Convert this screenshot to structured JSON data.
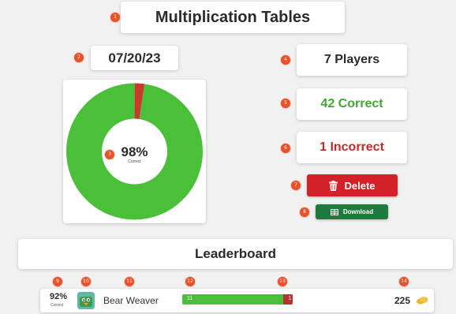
{
  "title": "Multiplication Tables",
  "date": "07/20/23",
  "stats": {
    "players": "7 Players",
    "correct": "42 Correct",
    "incorrect": "1 Incorrect"
  },
  "donut": {
    "percent_label": "98%",
    "caption": "Correct",
    "correct_fraction": 0.977
  },
  "buttons": {
    "delete_label": "Delete",
    "download_label": "Download"
  },
  "leaderboard": {
    "heading": "Leaderboard",
    "rows": [
      {
        "percent": "92%",
        "percent_caption": "Correct",
        "name": "Bear Weaver",
        "correct_count": "11",
        "incorrect_count": "1",
        "correct_fraction": 0.917,
        "score": "225",
        "avatar_icon": "duck-avatar-icon",
        "coin_icon": "coins-icon"
      }
    ]
  },
  "markers": [
    "1",
    "2",
    "3",
    "4",
    "5",
    "6",
    "7",
    "8",
    "9",
    "10",
    "11",
    "12",
    "13",
    "14"
  ],
  "colors": {
    "green": "#4cbf3a",
    "red": "#d32129",
    "dark_red": "#b83232",
    "marker": "#e8522a",
    "download_green": "#1f7a3d"
  }
}
